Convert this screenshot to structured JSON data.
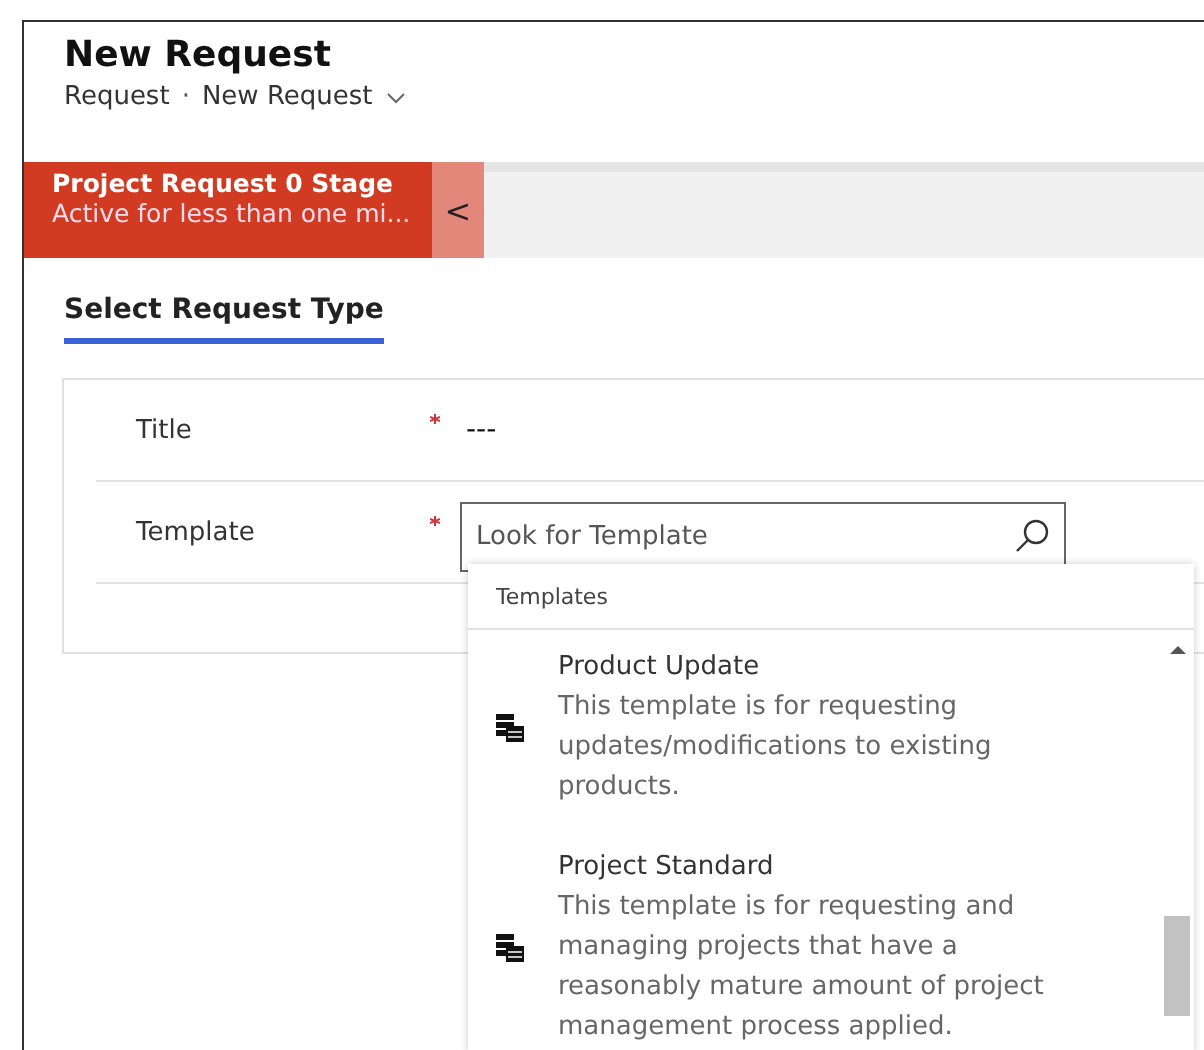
{
  "header": {
    "title": "New Request",
    "breadcrumb": [
      "Request",
      "·",
      "New Request"
    ]
  },
  "stage": {
    "name": "Project Request 0 Stage",
    "status": "Active for less than one mi...",
    "collapse_glyph": "<"
  },
  "tabs": [
    {
      "label": "Select Request Type",
      "selected": true
    }
  ],
  "fields": [
    {
      "label": "Title",
      "required": true,
      "value": "---"
    },
    {
      "label": "Template",
      "required": true,
      "placeholder": "Look for Template"
    }
  ],
  "dropdown": {
    "heading": "Templates",
    "items": [
      {
        "name": "Product Update",
        "description": "This template is for requesting updates/modifications to existing products."
      },
      {
        "name": "Project Standard",
        "description": "This template is for requesting and managing projects that have a reasonably mature amount of project management process applied."
      }
    ]
  }
}
